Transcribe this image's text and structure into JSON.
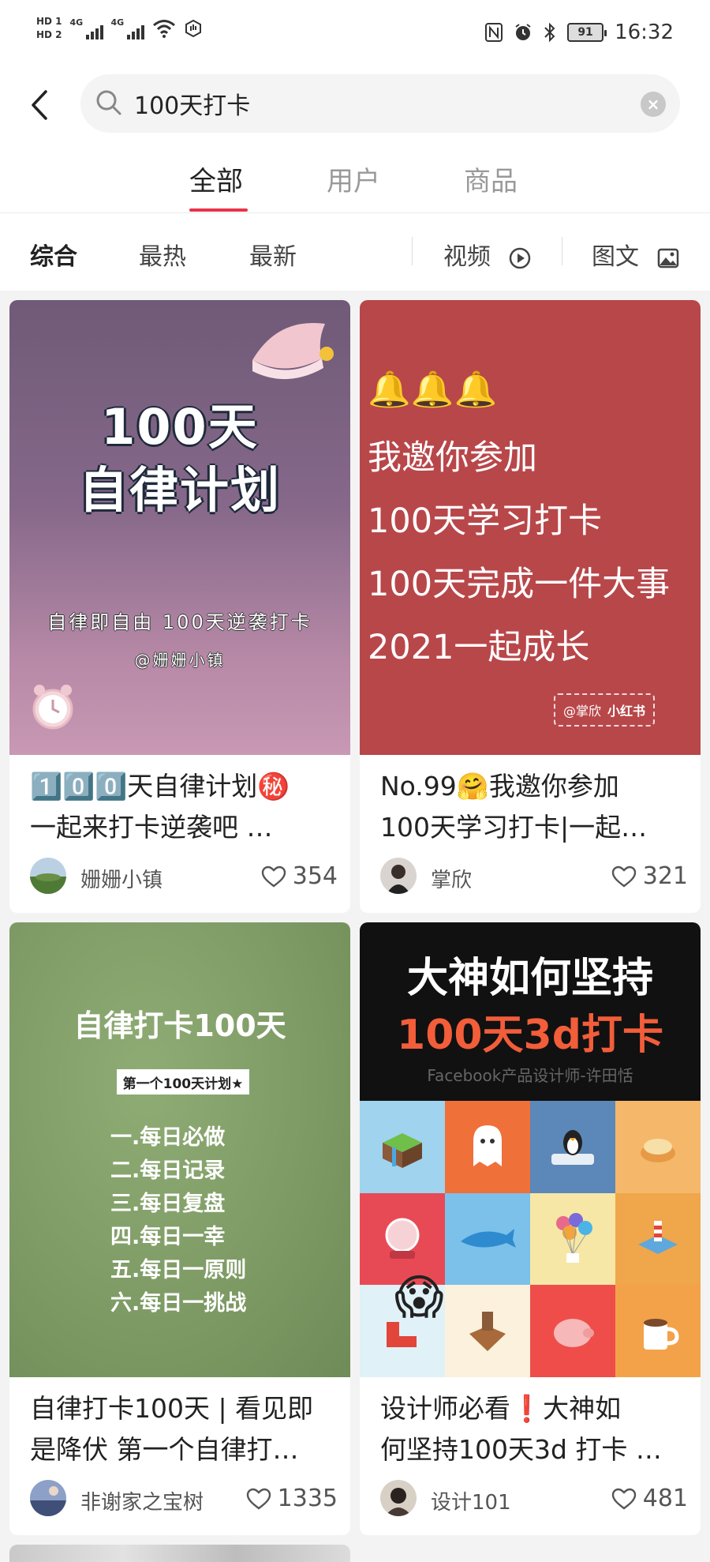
{
  "status_bar": {
    "hd1": "HD 1",
    "hd2": "HD 2",
    "net1": "4G",
    "net2": "4G",
    "battery": "91",
    "time": "16:32"
  },
  "search": {
    "query": "100天打卡"
  },
  "tabs": [
    {
      "label": "全部",
      "active": true
    },
    {
      "label": "用户",
      "active": false
    },
    {
      "label": "商品",
      "active": false
    }
  ],
  "filters": {
    "sort": [
      "综合",
      "最热",
      "最新"
    ],
    "video": "视频",
    "image_text": "图文"
  },
  "cards": [
    {
      "title_line1": "1️⃣0️⃣0️⃣天自律计划㊙️",
      "title_line2": "一起来打卡逆袭吧 …",
      "author": "姗姗小镇",
      "likes": "354",
      "cover": {
        "heading1": "100天",
        "heading2": "自律计划",
        "sub1": "自律即自由  100天逆袭打卡",
        "sub2": "@姗姗小镇"
      }
    },
    {
      "title_line1": "No.99🤗我邀你参加",
      "title_line2": "100天学习打卡|一起…",
      "author": "掌欣",
      "likes": "321",
      "cover": {
        "bells": "🔔🔔🔔",
        "lines": [
          "我邀你参加",
          "100天学习打卡",
          "100天完成一件大事",
          "2021一起成长"
        ],
        "brand_left": "@掌欣",
        "brand_right": "小红书"
      }
    },
    {
      "title_line1": "自律打卡100天 | 看见即",
      "title_line2": "是降伏 第一个自律打…",
      "author": "非谢家之宝树",
      "likes": "1335",
      "cover": {
        "heading": "自律打卡100天",
        "tag": "第一个100天计划★",
        "items": [
          "一.每日必做",
          "二.每日记录",
          "三.每日复盘",
          "四.每日一幸",
          "五.每日一原则",
          "六.每日一挑战"
        ]
      }
    },
    {
      "title_line1": "设计师必看❗️大神如",
      "title_line2": "何坚持100天3d 打卡 …",
      "author": "设计101",
      "likes": "481",
      "cover": {
        "heading1": "大神如何坚持",
        "heading2": "100天3d打卡",
        "sub": "Facebook产品设计师-许田恬",
        "emoji": "😱"
      }
    }
  ],
  "colors": {
    "accent": "#e8334a",
    "cover2_bg": "#b8474a",
    "cover3_bg": "#7e9b65"
  }
}
